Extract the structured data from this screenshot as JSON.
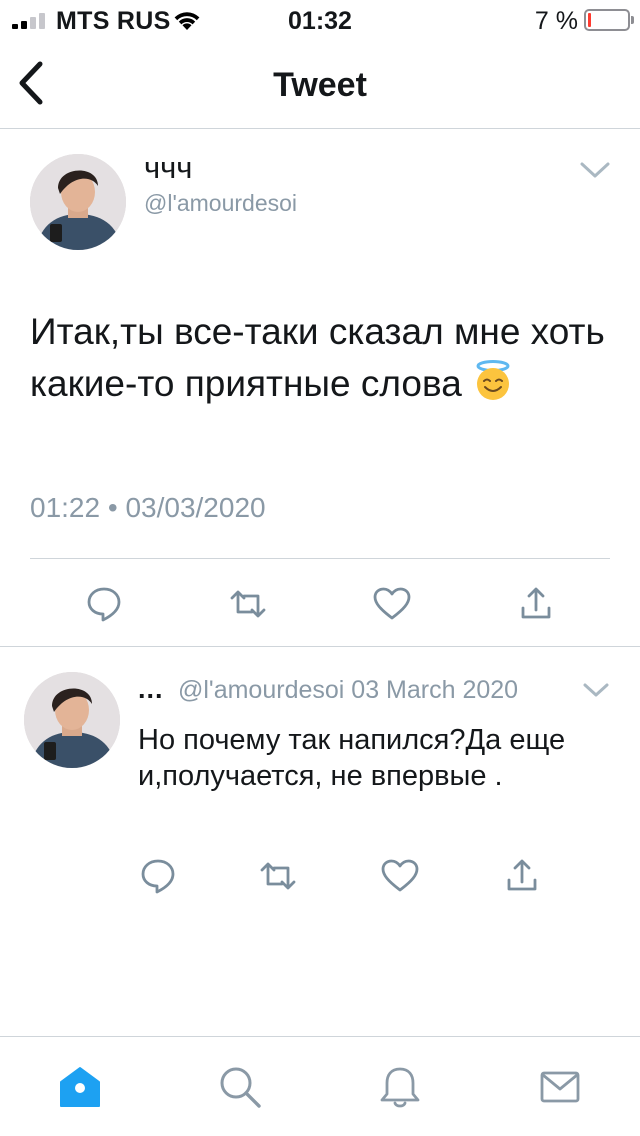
{
  "status_bar": {
    "carrier": "MTS RUS",
    "time": "01:32",
    "battery_percent_label": "7 %",
    "battery_level": 0.07,
    "signal_bars": 2,
    "signal_bars_total": 4
  },
  "nav": {
    "back_icon": "chevron-left-icon",
    "title": "Tweet"
  },
  "tweet": {
    "name": "ччч",
    "handle": "@l'amourdesoi",
    "text": "Итак,ты все-таки сказал мне хоть какие-то приятные слова",
    "emoji": "smiling-face-with-halo",
    "time": "01:22",
    "separator": "•",
    "date": "03/03/2020",
    "actions": [
      "reply-icon",
      "retweet-icon",
      "like-icon",
      "share-icon"
    ]
  },
  "reply": {
    "name": "...",
    "handle": "@l'amourdesoi",
    "date": "03 March 2020",
    "text": "Но почему так напился?Да еще и,получается, не впервые ."
  },
  "tab_bar": {
    "items": [
      "home-icon",
      "search-icon",
      "notifications-icon",
      "messages-icon"
    ],
    "active": "home-icon"
  },
  "colors": {
    "accent": "#1da1f2",
    "secondary_text": "#8a99a6",
    "action_icon": "#7a8d9c",
    "divider": "#cfd5da",
    "battery_low": "#ff3b30"
  }
}
